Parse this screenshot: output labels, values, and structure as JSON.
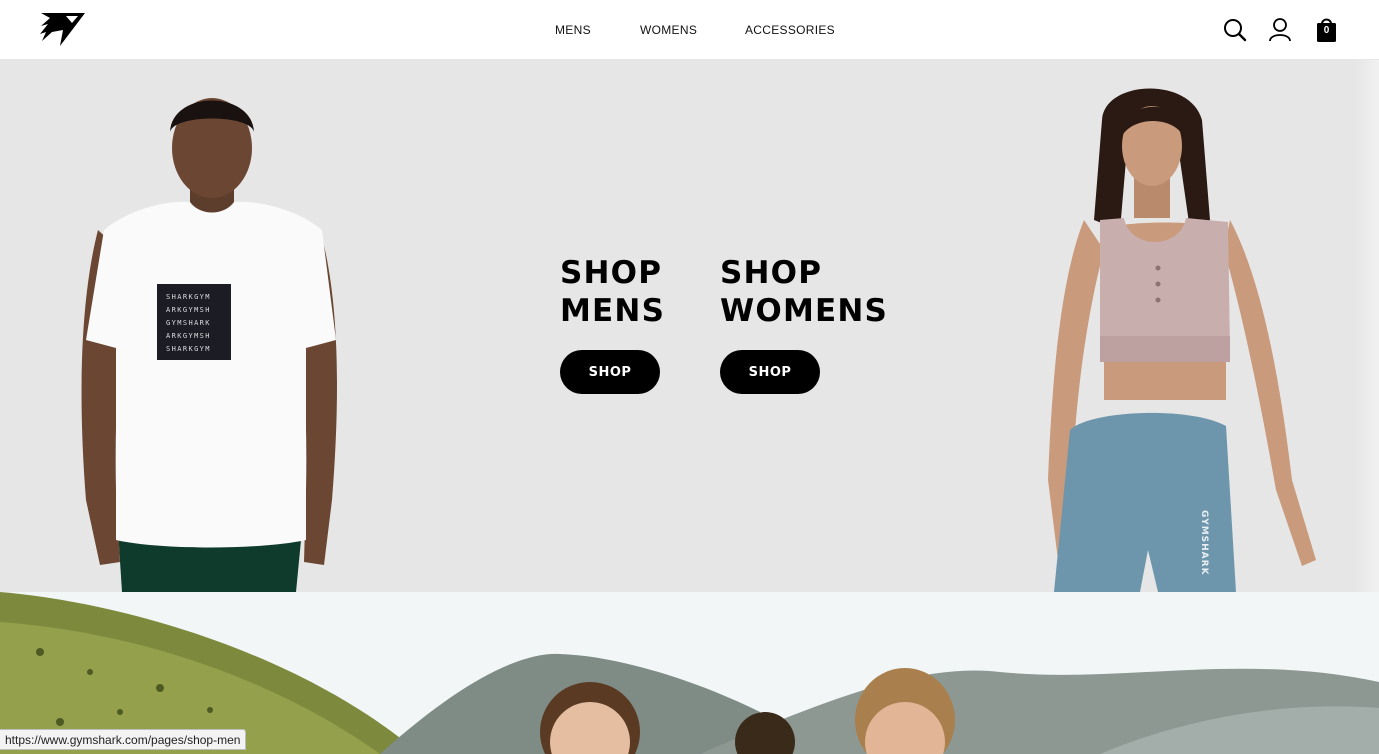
{
  "header": {
    "logo_name": "gymshark-logo",
    "nav": [
      {
        "label": "MENS"
      },
      {
        "label": "WOMENS"
      },
      {
        "label": "ACCESSORIES"
      }
    ],
    "icons": [
      "search-icon",
      "account-icon",
      "bag-icon"
    ],
    "bag_count": "0"
  },
  "hero": {
    "background": "#e6e6e6",
    "mens": {
      "line1": "SHOP",
      "line2": "MENS",
      "button_label": "SHOP"
    },
    "womens": {
      "line1": "SHOP",
      "line2": "WOMENS",
      "button_label": "SHOP"
    },
    "tshirt_print": [
      "SHARKGYM",
      "ARKGYMSH",
      "GYMSHARK",
      "ARKGYMSH",
      "SHARKGYM"
    ],
    "leggings_print": "GYMSHARK"
  },
  "status_bar": {
    "url": "https://www.gymshark.com/pages/shop-men"
  },
  "colors": {
    "accent": "#000000",
    "button_text": "#ffffff",
    "leggings": "#6d96ac",
    "sports_bra": "#c9aeae"
  }
}
